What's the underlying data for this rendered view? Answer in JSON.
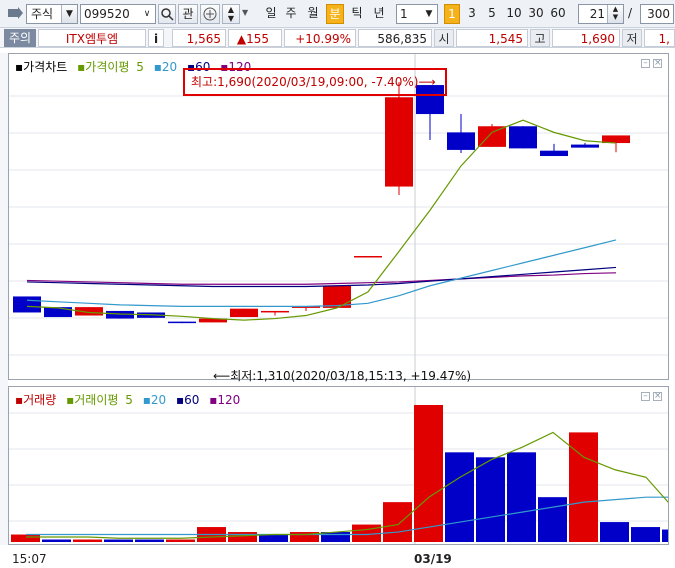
{
  "toolbar": {
    "market_select": "주식",
    "code_value": "099520",
    "btn_gwan": "관",
    "periods": [
      "일",
      "주",
      "월",
      "분",
      "틱",
      "년"
    ],
    "active_period": "분",
    "interval_value": "1",
    "interval_badge": "1",
    "minute_options": [
      "3",
      "5",
      "10",
      "30",
      "60"
    ],
    "count_value": "21",
    "slash": "/",
    "total_value": "300"
  },
  "quote": {
    "warn": "주의",
    "name": "ITX엠투엠",
    "info": "i",
    "price": "1,565",
    "change": "▲155",
    "change_pct": "+10.99%",
    "volume": "586,835",
    "open_label": "시",
    "open": "1,545",
    "high_label": "고",
    "high": "1,690",
    "low_label": "저",
    "low": "1,"
  },
  "price_panel": {
    "title": "가격차트",
    "ma_label": "가격이평",
    "ma_periods": [
      "5",
      "20",
      "60",
      "120"
    ],
    "high_annotation": "최고:1,690(2020/03/19,09:00, -7.40%)⟶",
    "low_annotation": "⟵최저:1,310(2020/03/18,15:13, +19.47%)"
  },
  "volume_panel": {
    "title": "거래량",
    "ma_label": "거래이평",
    "ma_periods": [
      "5",
      "20",
      "60",
      "120"
    ]
  },
  "axis": {
    "start_time": "15:07",
    "day_marker": "03/19"
  },
  "colors": {
    "up": "#e00000",
    "down": "#0000c8",
    "ma5": "#669900",
    "ma20": "#3399cc",
    "ma60": "#000080",
    "ma120": "#800080",
    "highlight_box": "#e00000"
  },
  "chart_data": {
    "type": "candlestick",
    "price_ylim": [
      1310,
      1690
    ],
    "candles": [
      {
        "o": 1409,
        "h": 1409,
        "l": 1388,
        "c": 1388
      },
      {
        "o": 1395,
        "h": 1395,
        "l": 1382,
        "c": 1382
      },
      {
        "o": 1384,
        "h": 1395,
        "l": 1384,
        "c": 1395
      },
      {
        "o": 1390,
        "h": 1390,
        "l": 1380,
        "c": 1380
      },
      {
        "o": 1388,
        "h": 1388,
        "l": 1381,
        "c": 1381
      },
      {
        "o": 1376,
        "h": 1376,
        "l": 1374,
        "c": 1375
      },
      {
        "o": 1375,
        "h": 1380,
        "l": 1375,
        "c": 1380
      },
      {
        "o": 1382,
        "h": 1393,
        "l": 1382,
        "c": 1393
      },
      {
        "o": 1390,
        "h": 1390,
        "l": 1384,
        "c": 1390
      },
      {
        "o": 1394,
        "h": 1396,
        "l": 1390,
        "c": 1396
      },
      {
        "o": 1394,
        "h": 1423,
        "l": 1394,
        "c": 1423
      },
      {
        "o": 1462,
        "h": 1462,
        "l": 1462,
        "c": 1462
      },
      {
        "o": 1553,
        "h": 1690,
        "l": 1542,
        "c": 1670
      },
      {
        "o": 1686,
        "h": 1686,
        "l": 1614,
        "c": 1648
      },
      {
        "o": 1624,
        "h": 1648,
        "l": 1597,
        "c": 1601
      },
      {
        "o": 1605,
        "h": 1635,
        "l": 1605,
        "c": 1632
      },
      {
        "o": 1632,
        "h": 1632,
        "l": 1603,
        "c": 1603
      },
      {
        "o": 1600,
        "h": 1609,
        "l": 1599,
        "c": 1593
      },
      {
        "o": 1608,
        "h": 1610,
        "l": 1604,
        "c": 1604
      },
      {
        "o": 1610,
        "h": 1610,
        "l": 1598,
        "c": 1620
      }
    ],
    "ma5": [
      1396,
      1394,
      1388,
      1386,
      1385,
      1383,
      1380,
      1378,
      1380,
      1384,
      1394,
      1415,
      1468,
      1522,
      1580,
      1624,
      1640,
      1624,
      1613,
      1610
    ],
    "ma20": [
      1404,
      1402,
      1400,
      1398,
      1397,
      1396,
      1396,
      1396,
      1396,
      1396,
      1397,
      1400,
      1410,
      1423,
      1433,
      1443,
      1453,
      1463,
      1473,
      1483
    ],
    "ma60": [
      1428,
      1427,
      1426,
      1425,
      1424,
      1423,
      1422,
      1422,
      1422,
      1422,
      1423,
      1424,
      1426,
      1429,
      1432,
      1435,
      1438,
      1441,
      1444,
      1447
    ],
    "ma120": [
      1430,
      1429,
      1428,
      1427,
      1426,
      1425,
      1425,
      1425,
      1425,
      1425,
      1426,
      1427,
      1428,
      1430,
      1432,
      1434,
      1436,
      1437,
      1439,
      1440
    ],
    "volume": [
      3,
      1,
      1,
      1,
      1,
      1,
      6,
      4,
      3,
      4,
      4,
      7,
      16,
      55,
      36,
      34,
      36,
      18,
      44,
      8,
      6,
      5
    ],
    "volume_up": [
      true,
      false,
      true,
      false,
      false,
      true,
      true,
      true,
      false,
      true,
      false,
      true,
      true,
      true,
      false,
      false,
      false,
      false,
      true,
      false,
      false,
      false
    ],
    "volume_ma5": [
      2,
      2,
      2,
      1.5,
      1.5,
      1.5,
      2,
      2.5,
      3,
      3,
      4,
      5,
      7,
      18,
      26,
      33,
      38,
      44,
      34,
      29,
      26,
      12
    ],
    "volume_ma20": [
      3,
      3,
      3,
      3,
      3,
      3,
      3,
      3,
      3,
      3,
      3,
      3,
      4,
      6,
      8,
      10,
      12,
      14,
      16,
      17,
      18,
      18
    ]
  }
}
